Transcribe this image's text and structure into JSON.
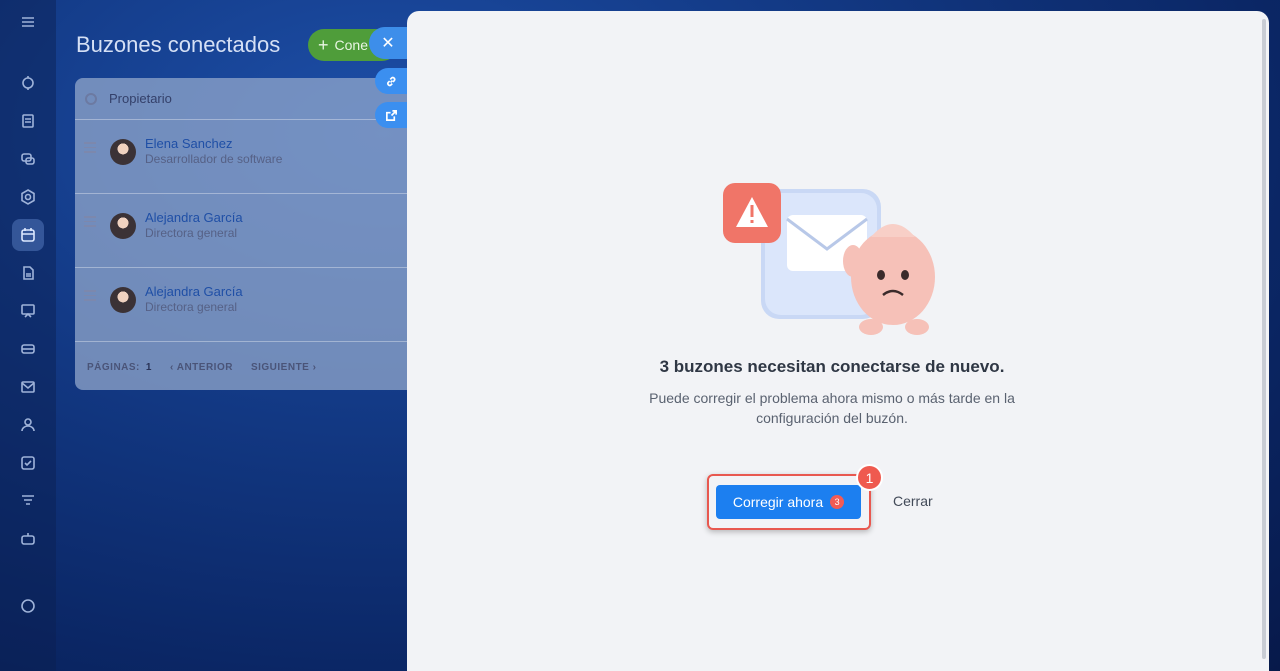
{
  "background": {
    "title": "Buzones conectados",
    "add_button_label": "Cone",
    "table": {
      "owner_column": "Propietario",
      "rows": [
        {
          "name": "Elena Sanchez",
          "role": "Desarrollador de software"
        },
        {
          "name": "Alejandra García",
          "role": "Directora general"
        },
        {
          "name": "Alejandra García",
          "role": "Directora general"
        }
      ],
      "pager": {
        "pages_label": "PÁGINAS:",
        "page_number": "1",
        "prev_label": "ANTERIOR",
        "next_label": "SIGUIENTE"
      }
    }
  },
  "slider": {
    "close_icon": "close-icon",
    "link_icon": "link-icon",
    "open_icon": "external-link-icon"
  },
  "dialog": {
    "title": "3 buzones necesitan conectarse de nuevo.",
    "description": "Puede corregir el problema ahora mismo o más tarde en la configuración del buzón.",
    "fix_button_label": "Corregir ahora",
    "fix_badge_count": "3",
    "step_number": "1",
    "close_label": "Cerrar"
  },
  "colors": {
    "primary": "#1c7ff0",
    "highlight": "#e8584f",
    "badge": "#f25b55"
  }
}
